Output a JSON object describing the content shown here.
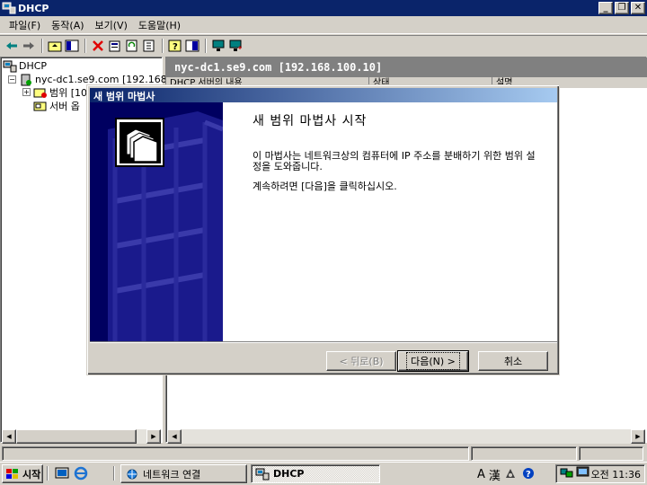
{
  "window": {
    "title": "DHCP"
  },
  "menu": {
    "items": [
      "파일(F)",
      "동작(A)",
      "보기(V)",
      "도움말(H)"
    ]
  },
  "tree": {
    "root": "DHCP",
    "server": "nyc-dc1.se9.com [192.168.",
    "scope": "범위 [10",
    "server_options": "서버 옵"
  },
  "right_pane": {
    "header": "nyc-dc1.se9.com [192.168.100.10]",
    "columns": [
      "DHCP 서버의 내용",
      "상태",
      "설명"
    ]
  },
  "wizard": {
    "title": "새 범위 마법사",
    "heading": "새 범위 마법사 시작",
    "desc1": "이 마법사는 네트워크상의 컴퓨터에 IP 주소를 분배하기 위한 범위 설정을 도와줍니다.",
    "desc2": "계속하려면 [다음]을 클릭하십시오.",
    "back_label": "< 뒤로(B)",
    "next_label": "다음(N) >",
    "cancel_label": "취소"
  },
  "taskbar": {
    "start_label": "시작",
    "tasks": [
      "네트워크 연결",
      "DHCP"
    ],
    "ime_a": "A",
    "ime_han": "漢",
    "clock": "오전 11:36"
  },
  "colors": {
    "titlebar": "#0a246a",
    "face": "#d4d0c8",
    "wizard_side": "#000060",
    "pane_header": "#808080"
  }
}
